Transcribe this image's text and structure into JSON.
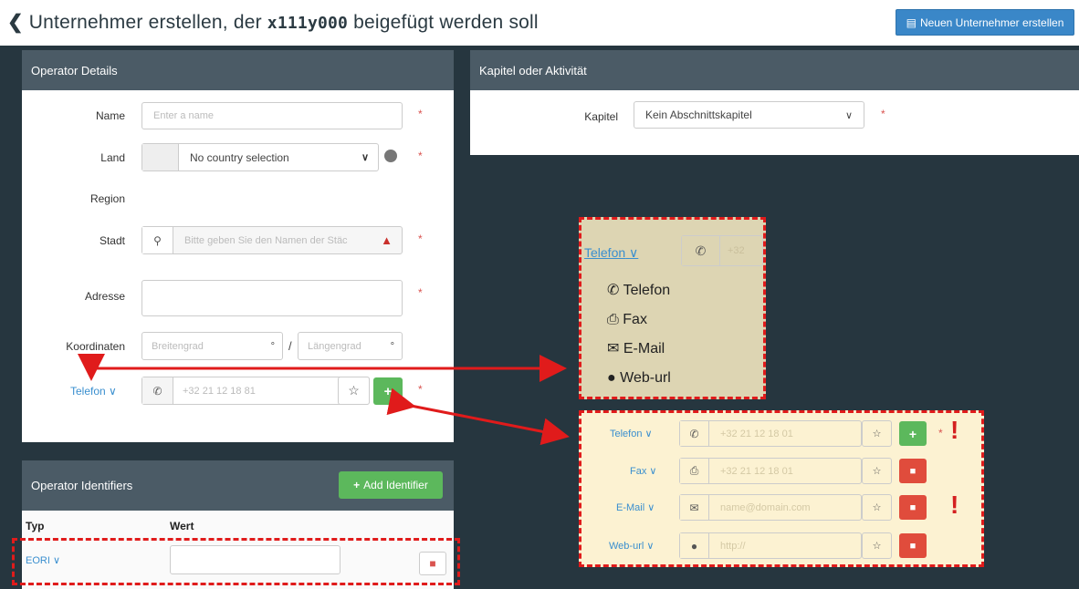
{
  "header": {
    "title_prefix": "Unternehmer erstellen, der",
    "title_code": "x111y000",
    "title_suffix": "beigefügt werden soll",
    "new_operator_label": "Neuen Unternehmer erstellen"
  },
  "operator_details": {
    "title": "Operator Details",
    "name_label": "Name",
    "name_placeholder": "Enter a name",
    "country_label": "Land",
    "country_value": "No country selection",
    "region_label": "Region",
    "city_label": "Stadt",
    "city_placeholder": "Bitte geben Sie den Namen der Stäc",
    "address_label": "Adresse",
    "coords_label": "Koordinaten",
    "lat_placeholder": "Breitengrad",
    "lon_placeholder": "Längengrad",
    "degree": "°",
    "slash": "/",
    "phone_type": "Telefon",
    "phone_placeholder": "+32 21 12 18 81",
    "required_mark": "*"
  },
  "chapter_panel": {
    "title": "Kapitel oder Aktivität",
    "chapter_label": "Kapitel",
    "chapter_value": "Kein Abschnittskapitel"
  },
  "identifiers": {
    "title": "Operator Identifiers",
    "add_label": "Add Identifier",
    "col_type": "Typ",
    "col_value": "Wert",
    "row_type": "EORI"
  },
  "dropdown_callout": {
    "trigger_label": "Telefon",
    "phone_prefix": "+32",
    "items": [
      "Telefon",
      "Fax",
      "E-Mail",
      "Web-url"
    ]
  },
  "contacts_callout": {
    "rows": [
      {
        "type": "Telefon",
        "placeholder": "+32 21 12 18 01"
      },
      {
        "type": "Fax",
        "placeholder": "+32 21 12 18 01"
      },
      {
        "type": "E-Mail",
        "placeholder": "name@domain.com"
      },
      {
        "type": "Web-url",
        "placeholder": "http://"
      }
    ],
    "exclamation": "!"
  },
  "colors": {
    "accent_blue": "#3a87c8",
    "panel_header": "#4b5b66",
    "background": "#26363f",
    "annotation_red": "#e01b1b",
    "add_green": "#5cb85c",
    "delete_red": "#e04c3c"
  }
}
